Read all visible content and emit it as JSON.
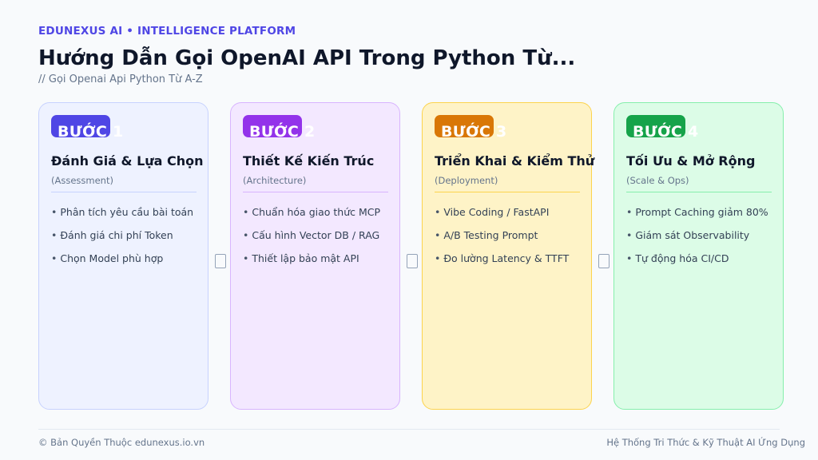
{
  "header": {
    "brand": "EDUNEXUS AI • INTELLIGENCE PLATFORM",
    "title": "Hướng Dẫn Gọi OpenAI API Trong Python Từ...",
    "subtitle": "// Gọi Openai Api Python Từ A-Z"
  },
  "steps": [
    {
      "badge": "BƯỚC 1",
      "title": "Đánh Giá & Lựa Chọn",
      "subtitle": "(Assessment)",
      "items": [
        "Phân tích yêu cầu bài toán",
        "Đánh giá chi phí Token",
        "Chọn Model phù hợp"
      ],
      "accent": "#4f46e5",
      "bg": "#eef2ff",
      "border": "#c7d2fe"
    },
    {
      "badge": "BƯỚC 2",
      "title": "Thiết Kế Kiến Trúc",
      "subtitle": "(Architecture)",
      "items": [
        "Chuẩn hóa giao thức MCP",
        "Cấu hình Vector DB / RAG",
        "Thiết lập bảo mật API"
      ],
      "accent": "#9333ea",
      "bg": "#f3e8ff",
      "border": "#d8b4fe"
    },
    {
      "badge": "BƯỚC 3",
      "title": "Triển Khai & Kiểm Thử",
      "subtitle": "(Deployment)",
      "items": [
        "Vibe Coding / FastAPI",
        "A/B Testing Prompt",
        "Đo lường Latency & TTFT"
      ],
      "accent": "#d97706",
      "bg": "#fef3c7",
      "border": "#fcd34d"
    },
    {
      "badge": "BƯỚC 4",
      "title": "Tối Ưu & Mở Rộng",
      "subtitle": "(Scale & Ops)",
      "items": [
        "Prompt Caching giảm 80%",
        "Giám sát Observability",
        "Tự động hóa CI/CD"
      ],
      "accent": "#16a34a",
      "bg": "#dcfce7",
      "border": "#86efac"
    }
  ],
  "footer": {
    "left": "© Bản Quyền Thuộc edunexus.io.vn",
    "right": "Hệ Thống Tri Thức & Kỹ Thuật AI Ứng Dụng"
  }
}
